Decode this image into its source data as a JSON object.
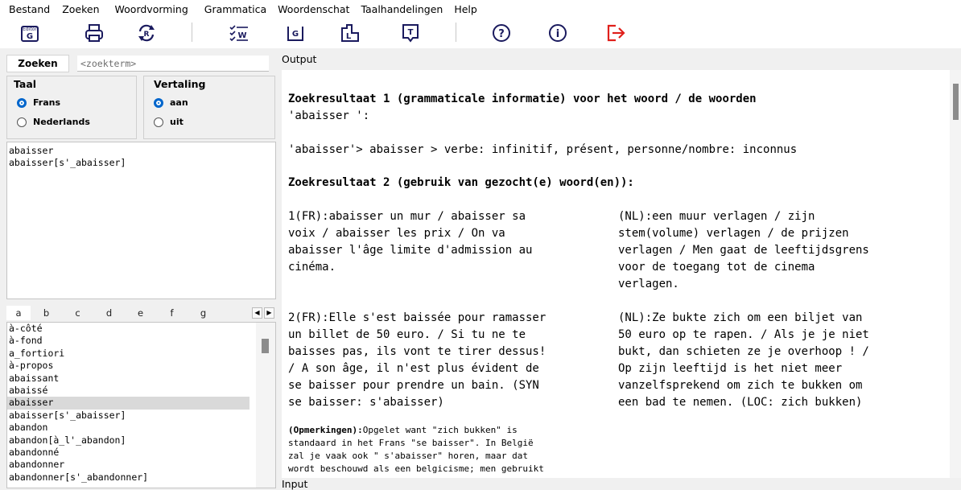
{
  "menu": [
    "Bestand",
    "Zoeken",
    "Woordvorming",
    "Grammatica",
    "Woordenschat",
    "Taalhandelingen",
    "Help"
  ],
  "toolbar": {
    "editor_icon_text": "Editor",
    "editor_icon_letter": "G",
    "refresh_letter": "R",
    "list_letter": "W",
    "grammar_letter": "G",
    "lexicon_letter": "L",
    "text_letter": "T",
    "help_symbol": "?",
    "info_symbol": "i",
    "exit_color": "#e0201b",
    "icon_color": "#1a1a5e"
  },
  "search": {
    "button_label": "Zoeken",
    "input_value": "<zoekterm>"
  },
  "taal": {
    "title": "Taal",
    "options": [
      "Frans",
      "Nederlands"
    ],
    "selected": "Frans"
  },
  "vertaling": {
    "title": "Vertaling",
    "options": [
      "aan",
      "uit"
    ],
    "selected": "aan"
  },
  "results": [
    "abaisser",
    "abaisser[s'_abaisser]"
  ],
  "alphabet": [
    "a",
    "b",
    "c",
    "d",
    "e",
    "f",
    "g"
  ],
  "wordlist": {
    "items": [
      "à-côté",
      "à-fond",
      "a_fortiori",
      "à-propos",
      "abaissant",
      "abaissé",
      "abaisser",
      "abaisser[s'_abaisser]",
      "abandon",
      "abandon[à_l'_abandon]",
      "abandonné",
      "abandonner",
      "abandonner[s'_abandonner]"
    ],
    "selected": "abaisser"
  },
  "output": {
    "label": "Output",
    "result1_title_l1": "Zoekresultaat 1 (grammaticale informatie) voor het woord / de woorden",
    "result1_title_l2": "'abaisser ':",
    "result1_body": "'abaisser'> abaisser > verbe: infinitif, présent, personne/nombre: inconnus",
    "result2_title": "Zoekresultaat 2 (gebruik van gezocht(e) woord(en)):",
    "ex1_fr": "1(FR):abaisser un mur / abaisser sa\nvoix / abaisser les prix / On va\nabaisser l'âge limite d'admission au\ncinéma.",
    "ex1_nl": "(NL):een muur verlagen / zijn\nstem(volume) verlagen / de prijzen\nverlagen / Men gaat de leeftijdsgrens\nvoor de toegang tot de cinema\nverlagen.",
    "ex2_fr": "2(FR):Elle s'est baissée pour ramasser\nun billet de 50 euro. / Si tu ne te\nbaisses pas, ils vont te tirer dessus!\n/ A son âge, il n'est plus évident de\nse baisser pour prendre un bain. (SYN\nse baisser: s'abaisser)",
    "ex2_nl": "(NL):Ze bukte zich om een biljet van\n50 euro op te rapen. / Als je je niet\nbukt, dan schieten ze je overhoop ! /\nOp zijn leeftijd is het niet meer\nvanzelfsprekend om zich te bukken om\neen bad te nemen. (LOC: zich bukken)",
    "note_label": "(Opmerkingen):",
    "note_text": "Opgelet want \"zich bukken\" is\nstandaard in het Frans \"se baisser\". In België\nzal je vaak ook \" s'abaisser\" horen, maar dat\nwordt beschouwd als een belgicisme; men gebruikt"
  },
  "input_label": "Input"
}
